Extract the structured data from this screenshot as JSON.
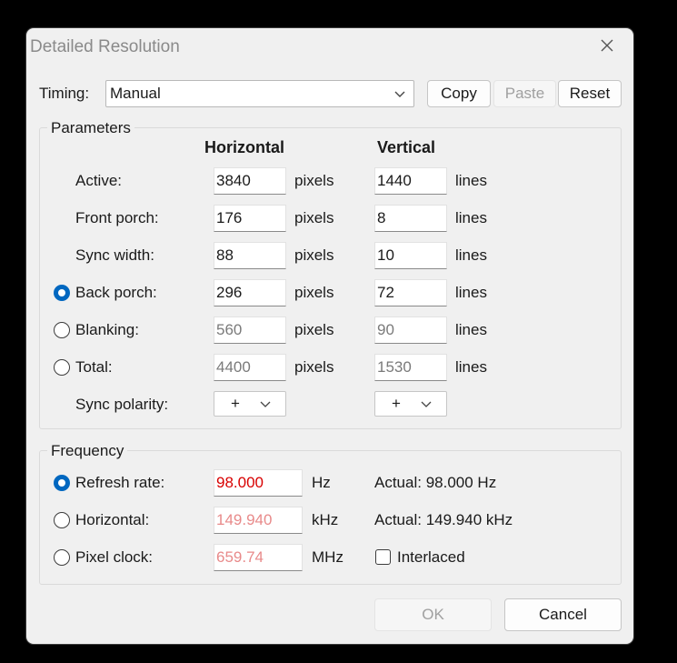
{
  "window": {
    "title": "Detailed Resolution"
  },
  "timing": {
    "label": "Timing:",
    "value": "Manual"
  },
  "toolbar": {
    "copy": "Copy",
    "paste": "Paste",
    "reset": "Reset"
  },
  "parameters": {
    "group_label": "Parameters",
    "col_horizontal": "Horizontal",
    "col_vertical": "Vertical",
    "h_unit": "pixels",
    "v_unit": "lines",
    "rows": [
      {
        "label": "Active:",
        "h": "3840",
        "v": "1440"
      },
      {
        "label": "Front porch:",
        "h": "176",
        "v": "8"
      },
      {
        "label": "Sync width:",
        "h": "88",
        "v": "10"
      },
      {
        "label": "Back porch:",
        "h": "296",
        "v": "72"
      },
      {
        "label": "Blanking:",
        "h": "560",
        "v": "90"
      },
      {
        "label": "Total:",
        "h": "4400",
        "v": "1530"
      }
    ],
    "sync_polarity": {
      "label": "Sync polarity:",
      "h": "+",
      "v": "+"
    }
  },
  "frequency": {
    "group_label": "Frequency",
    "refresh": {
      "label": "Refresh rate:",
      "value": "98.000",
      "unit": "Hz",
      "actual": "Actual: 98.000 Hz"
    },
    "horizontal": {
      "label": "Horizontal:",
      "value": "149.940",
      "unit": "kHz",
      "actual": "Actual: 149.940 kHz"
    },
    "pixel_clock": {
      "label": "Pixel clock:",
      "value": "659.74",
      "unit": "MHz"
    },
    "interlaced": {
      "label": "Interlaced",
      "checked": false
    }
  },
  "footer": {
    "ok": "OK",
    "cancel": "Cancel"
  },
  "colors": {
    "accent": "#0067c0",
    "error_text": "#d80000",
    "error_text_disabled": "#e88a8a"
  }
}
